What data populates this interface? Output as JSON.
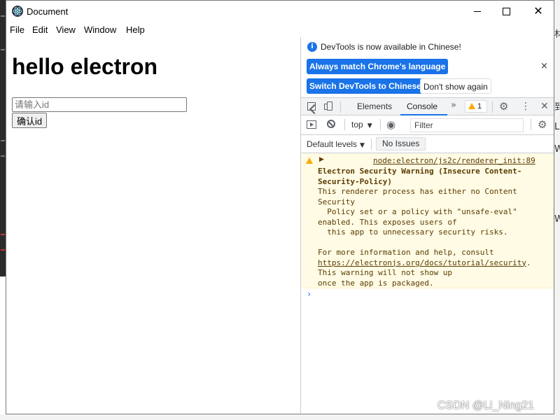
{
  "window": {
    "title": "Document",
    "menu": [
      "File",
      "Edit",
      "View",
      "Window",
      "Help"
    ],
    "controls": {
      "minimize": "",
      "maximize": "",
      "close": "✕"
    }
  },
  "page": {
    "heading": "hello electron",
    "id_input": {
      "placeholder": "请输入id",
      "value": ""
    },
    "confirm_label": "确认id"
  },
  "devtools": {
    "banner": {
      "message": "DevTools is now available in Chinese!",
      "always_match": "Always match Chrome's language",
      "switch": "Switch DevTools to Chinese",
      "dont_show": "Don't show again",
      "close": "×"
    },
    "tabs": [
      {
        "label": "Elements",
        "active": false
      },
      {
        "label": "Console",
        "active": true
      }
    ],
    "more": "»",
    "warning_count": "1",
    "toolbar": {
      "context": "top",
      "filter_placeholder": "Filter"
    },
    "levels": {
      "label": "Default levels",
      "issues": "No Issues"
    },
    "console": {
      "source": "node:electron/js2c/renderer_init:89",
      "title_lines": "Electron Security Warning (Insecure Content-\nSecurity-Policy)",
      "body_lines": "This renderer process has either no Content\nSecurity\n  Policy set or a policy with \"unsafe-eval\"\nenabled. This exposes users of\n  this app to unnecessary security risks.\n\nFor more information and help, consult\n",
      "link": "https://electronjs.org/docs/tutorial/security",
      "tail": ".\nThis warning will not show up\nonce the app is packaged.",
      "prompt": "›"
    },
    "accent_color": "#1a73e8",
    "warning_bg": "#fffbe5"
  },
  "desktop": {
    "right_glyphs": [
      "材",
      "到",
      "L",
      "W",
      "W"
    ]
  },
  "watermark": "CSDN @Li_Ning21"
}
